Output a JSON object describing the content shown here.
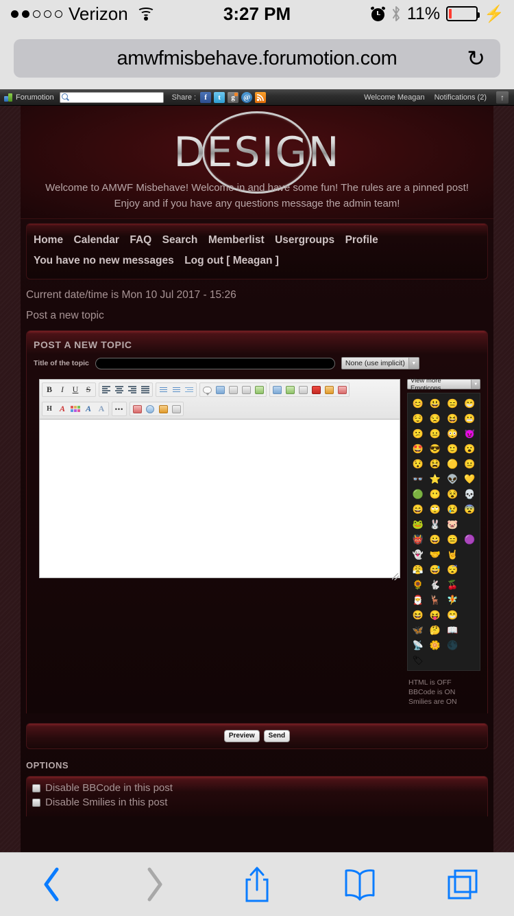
{
  "status_bar": {
    "carrier": "Verizon",
    "signal_dots_filled": 2,
    "signal_dots_total": 5,
    "time": "3:27 PM",
    "battery_percent": "11%",
    "battery_fill_pct": 11,
    "battery_color": "#ff3b30",
    "charging": true,
    "bluetooth_on": true,
    "alarm_on": true
  },
  "browser": {
    "url": "amwfmisbehave.forumotion.com",
    "reload_glyph": "↻",
    "back_enabled": true,
    "forward_enabled": false,
    "back_color": "#0a7cff",
    "forward_color": "#a8a8a8",
    "share_color": "#0a7cff",
    "bookmarks_color": "#0a7cff",
    "tabs_color": "#0a7cff"
  },
  "forumotion_bar": {
    "brand": "Forumotion",
    "search_placeholder": "",
    "search_value": "",
    "share_label": "Share :",
    "share_icons": [
      {
        "name": "facebook-icon",
        "glyph": "f"
      },
      {
        "name": "twitter-icon",
        "glyph": "t"
      },
      {
        "name": "googleplus-icon",
        "glyph": "g"
      },
      {
        "name": "email-icon",
        "glyph": "@"
      },
      {
        "name": "rss-icon",
        "glyph": "◔"
      }
    ],
    "welcome": "Welcome Meagan",
    "notifications": "Notifications  (2)",
    "collapse_glyph": "↑"
  },
  "banner": {
    "logo_text": "DESIGN",
    "tagline": "Welcome to AMWF Misbehave! Welcome in and have some fun! The rules are a pinned post! Enjoy and if you have any questions message the admin team!"
  },
  "nav": {
    "links": [
      "Home",
      "Calendar",
      "FAQ",
      "Search",
      "Memberlist",
      "Usergroups",
      "Profile",
      "You have no new messages",
      "Log out [ Meagan ]"
    ]
  },
  "page": {
    "datetime": "Current date/time is Mon 10 Jul 2017 - 15:26",
    "post_new_topic_link": "Post a new topic"
  },
  "post_form": {
    "panel_title": "POST A NEW TOPIC",
    "title_label": "Title of the topic",
    "title_value": "",
    "title_placeholder": "",
    "icon_select_value": "None (use implicit)",
    "select_arrow": "▼",
    "message_value": "",
    "message_placeholder": ""
  },
  "toolbar": {
    "row1": [
      {
        "name": "bold-icon",
        "label": "B"
      },
      {
        "name": "italic-icon",
        "label": "I"
      },
      {
        "name": "underline-icon",
        "label": "U"
      },
      {
        "name": "strikethrough-icon",
        "label": "S"
      },
      {
        "name": "align-left-icon",
        "label": ""
      },
      {
        "name": "align-center-icon",
        "label": ""
      },
      {
        "name": "align-right-icon",
        "label": ""
      },
      {
        "name": "align-justify-icon",
        "label": ""
      },
      {
        "name": "bullet-list-icon",
        "label": ""
      },
      {
        "name": "numbered-list-icon",
        "label": ""
      },
      {
        "name": "indent-icon",
        "label": ""
      },
      {
        "name": "quote-icon",
        "label": ""
      },
      {
        "name": "code-icon",
        "label": ""
      },
      {
        "name": "spoiler-icon",
        "label": ""
      },
      {
        "name": "hide-icon",
        "label": ""
      },
      {
        "name": "table-icon",
        "label": ""
      },
      {
        "name": "insert-image-icon",
        "label": ""
      },
      {
        "name": "upload-image-icon",
        "label": ""
      },
      {
        "name": "link-icon",
        "label": ""
      },
      {
        "name": "youtube-icon",
        "label": ""
      },
      {
        "name": "flash-icon",
        "label": ""
      },
      {
        "name": "highlight-icon",
        "label": ""
      }
    ],
    "row2": [
      {
        "name": "heading-icon",
        "label": "H"
      },
      {
        "name": "font-color-icon",
        "label": "A"
      },
      {
        "name": "color-palette-icon",
        "label": ""
      },
      {
        "name": "font-family-icon",
        "label": "A"
      },
      {
        "name": "font-size-icon",
        "label": "A"
      },
      {
        "name": "more-options-icon",
        "label": "•••"
      },
      {
        "name": "calendar-icon",
        "label": ""
      },
      {
        "name": "search-editor-icon",
        "label": ""
      },
      {
        "name": "paste-icon",
        "label": ""
      },
      {
        "name": "source-view-icon",
        "label": ""
      }
    ]
  },
  "emoticons": {
    "header": "View more Emoticons",
    "header_arrow": "▼",
    "items": [
      "😊",
      "😃",
      "😑",
      "😁",
      "😌",
      "😒",
      "😆",
      "😬",
      "😕",
      "😐",
      "😳",
      "😈",
      "🤩",
      "😎",
      "🙂",
      "😮",
      "😯",
      "😫",
      "🟡",
      "😐",
      "👓",
      "⭐",
      "👽",
      "💛",
      "🟢",
      "😶",
      "😵",
      "💀",
      "😄",
      "🙄",
      "😢",
      "😨",
      "🐸",
      "🐰",
      "🐷",
      "",
      "👹",
      "😀",
      "😑",
      "🟣",
      "👻",
      "🤝",
      "🤘",
      "",
      "😤",
      "😅",
      "😴",
      "",
      "🌻",
      "🐇",
      "🍒",
      "",
      "🎅",
      "🦌",
      "🧚",
      "",
      "😆",
      "😝",
      "😁",
      "",
      "🦋",
      "🤔",
      "📖",
      "",
      "📡",
      "🌼",
      "🌑",
      "",
      "🏷",
      "",
      "",
      ""
    ],
    "status_lines": [
      "HTML is OFF",
      "BBCode is ON",
      "Smilies are ON"
    ]
  },
  "actions": {
    "preview": "Preview",
    "send": "Send"
  },
  "options": {
    "title": "OPTIONS",
    "items": [
      {
        "label": "Disable BBCode in this post",
        "checked": false
      },
      {
        "label": "Disable Smilies in this post",
        "checked": false
      }
    ]
  }
}
